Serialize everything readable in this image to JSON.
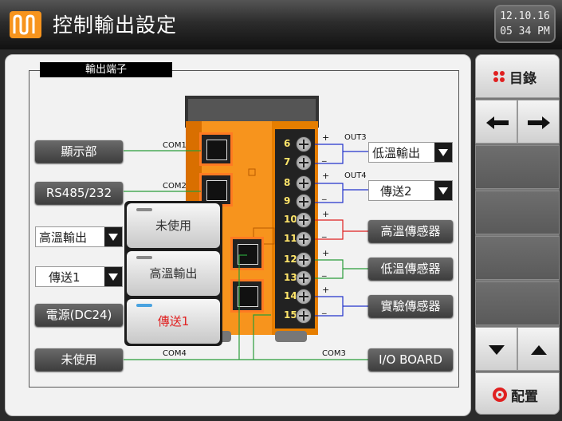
{
  "header": {
    "title": "控制輸出設定",
    "clock_date": "12.10.16",
    "clock_time": "05 34 PM"
  },
  "panel": {
    "frame_label": "輸出端子"
  },
  "left_buttons": {
    "display": "顯示部",
    "rs485": "RS485/232",
    "power": "電源(DC24)",
    "unused": "未使用"
  },
  "left_selects": {
    "sel1": "高溫輸出",
    "sel2": "傳送1"
  },
  "dropdown_menu": {
    "items": [
      "未使用",
      "高溫輸出",
      "傳送1"
    ],
    "selected_index": 2
  },
  "wire_labels": {
    "com1": "COM1",
    "com2": "COM2",
    "com3": "COM3",
    "com4": "COM4",
    "out3": "OUT3",
    "out4": "OUT4"
  },
  "terminals": [
    "6",
    "7",
    "8",
    "9",
    "10",
    "11",
    "12",
    "13",
    "14",
    "15"
  ],
  "polarity": {
    "plus": "+",
    "minus": "_"
  },
  "right_selects": {
    "out3": "低溫輸出",
    "out4": "傳送2"
  },
  "right_buttons": {
    "high_sensor": "高溫傳感器",
    "low_sensor": "低溫傳感器",
    "exp_sensor": "實驗傳感器",
    "io_board": "I/O BOARD"
  },
  "sidebar": {
    "index_label": "目錄",
    "config_label": "配置"
  },
  "colors": {
    "accent_orange": "#f7941d",
    "wire_green": "#2a9d3a",
    "wire_blue": "#2233cc",
    "wire_red": "#e02020",
    "selected_text": "#e02020"
  }
}
